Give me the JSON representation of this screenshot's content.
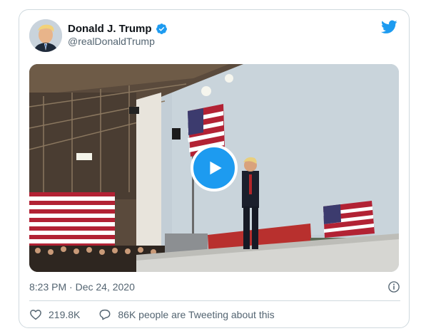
{
  "tweet": {
    "author": {
      "display_name": "Donald J. Trump",
      "handle": "@realDonaldTrump",
      "verified": true
    },
    "timestamp": "8:23 PM · Dec 24, 2020",
    "likes": "219.8K",
    "conversation": "86K people are Tweeting about this",
    "media": {
      "type": "video",
      "icon": "play-icon"
    }
  },
  "icons": {
    "brand": "twitter-bird-icon",
    "verified": "verified-badge-icon",
    "info": "info-icon",
    "like": "heart-icon",
    "reply": "speech-bubble-icon"
  },
  "colors": {
    "accent": "#1d9bf0",
    "text_primary": "#0f1419",
    "text_secondary": "#536471",
    "border": "#cfd9de"
  }
}
